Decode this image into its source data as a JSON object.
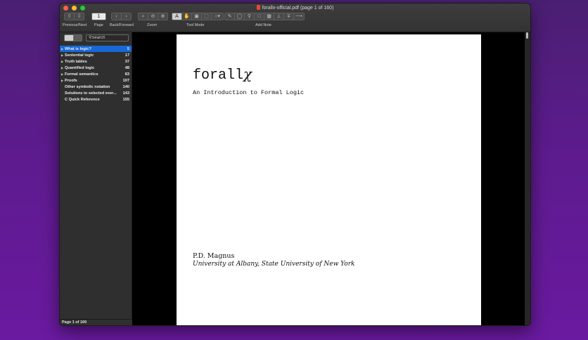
{
  "window": {
    "title": "forallx-official.pdf (page 1 of 160)"
  },
  "colors": {
    "close": "#fe5f57",
    "minimize": "#febc2e",
    "zoom": "#28c840",
    "selection": "#1868d6"
  },
  "toolbar": {
    "prev_next_label": "Previous/Next",
    "page_label": "Page",
    "page_value": "1",
    "back_forward_label": "Back/Forward",
    "zoom_label": "Zoom",
    "tool_mode_label": "Tool Mode",
    "add_note_label": "Add Note"
  },
  "sidebar": {
    "search_placeholder": "Search",
    "toc": [
      {
        "label": "What is logic?",
        "page": "5",
        "selected": true,
        "expandable": true
      },
      {
        "label": "Sentential logic",
        "page": "17",
        "expandable": true
      },
      {
        "label": "Truth tables",
        "page": "37",
        "expandable": true
      },
      {
        "label": "Quantified logic",
        "page": "48",
        "expandable": true
      },
      {
        "label": "Formal semantics",
        "page": "83",
        "expandable": true
      },
      {
        "label": "Proofs",
        "page": "107",
        "expandable": true
      },
      {
        "label": "Other symbolic notation",
        "page": "140",
        "expandable": false
      },
      {
        "label": "Solutions to selected exer...",
        "page": "143",
        "expandable": false
      },
      {
        "label": "C Quick Reference",
        "page": "155",
        "expandable": false
      }
    ]
  },
  "status": {
    "page_indicator": "Page 1 of 160"
  },
  "document": {
    "title_prefix": "forall",
    "title_symbol": "𝜒",
    "subtitle": "An Introduction to Formal Logic",
    "author": "P.D. Magnus",
    "affiliation": "University at Albany, State University of New York"
  }
}
